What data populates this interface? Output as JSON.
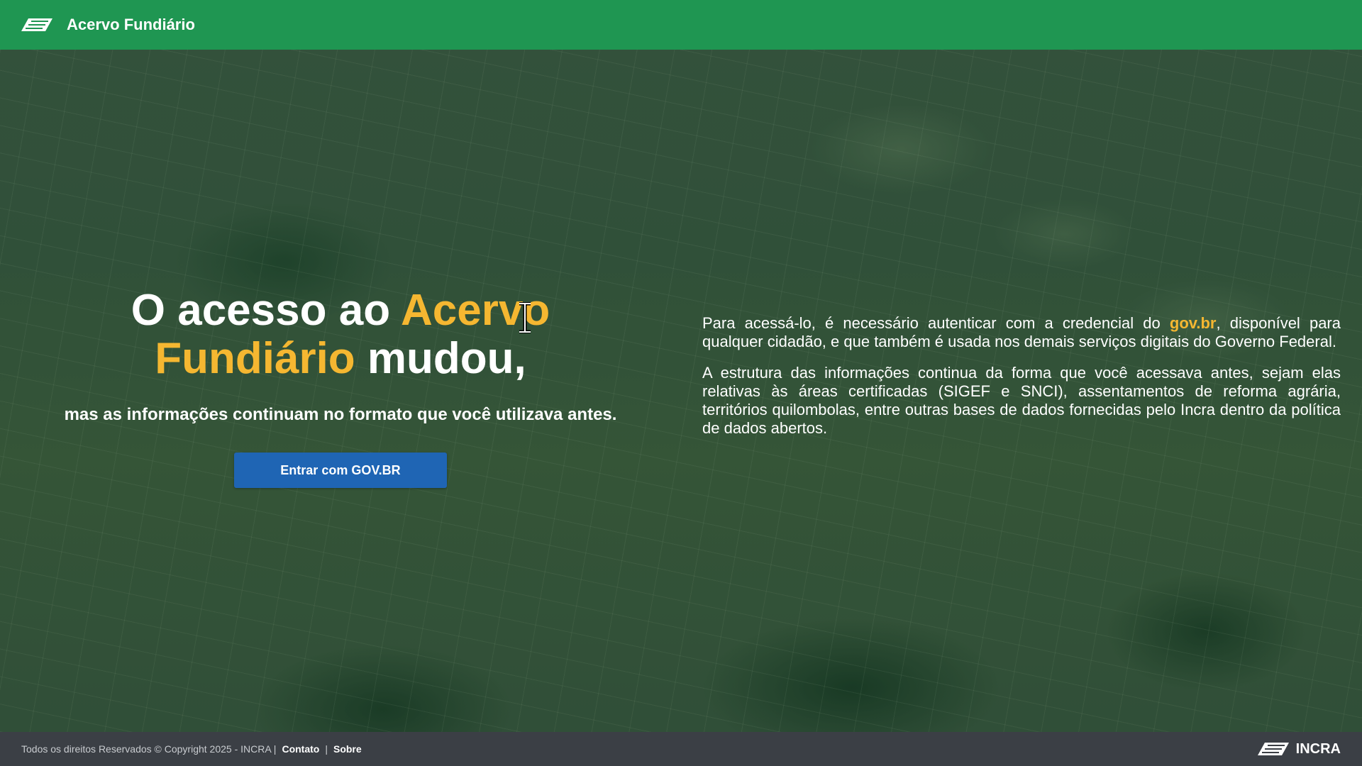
{
  "header": {
    "title": "Acervo Fundiário",
    "logo_icon": "incra-logo-icon"
  },
  "hero": {
    "headline_part1": "O acesso ao ",
    "headline_highlight": "Acervo Fundiário",
    "headline_part2": " mudou,",
    "subline": "mas as informações continuam no formato que você utilizava antes.",
    "login_button": "Entrar com GOV.BR"
  },
  "info": {
    "p1_before": "Para acessá-lo, é necessário autenticar com a credencial do ",
    "p1_link": "gov.br",
    "p1_after": ", disponível para qualquer cidadão, e que também é usada nos demais serviços digitais do Governo Federal.",
    "p2": "A estrutura das informações continua da forma que você acessava antes, sejam elas relativas às áreas certificadas (SIGEF e SNCI), assentamentos de reforma agrária, territórios quilombolas, entre outras bases de dados fornecidas pelo Incra dentro da política de dados abertos."
  },
  "footer": {
    "copyright": "Todos os direitos Reservados © Copyright 2025 - INCRA |",
    "contact": "Contato",
    "separator": "|",
    "about": "Sobre",
    "brand": "INCRA"
  },
  "colors": {
    "header": "#1f9652",
    "accent": "#f5b731",
    "button": "#1f65b4",
    "footer": "#3b3f45"
  }
}
